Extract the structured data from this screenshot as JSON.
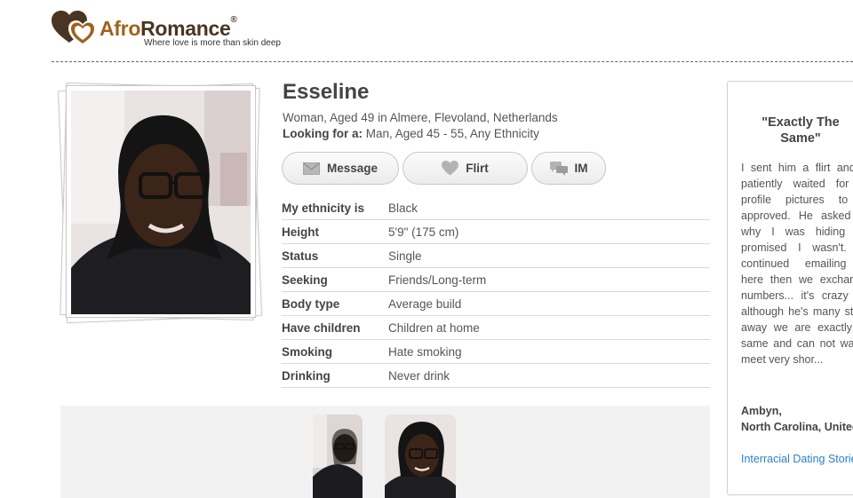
{
  "brand": {
    "name_part1": "Afro",
    "name_part2": "Romance",
    "registered_mark": "®",
    "tagline": "Where love is more than skin deep",
    "colors": {
      "primary": "#a0621e",
      "dark": "#4a3522"
    }
  },
  "profile": {
    "name": "Esseline",
    "summary": "Woman, Aged 49 in Almere, Flevoland, Netherlands",
    "looking_for_label": "Looking for a:",
    "looking_for_value": " Man, Aged 45 - 55, Any Ethnicity",
    "photo_icon": "profile-photo"
  },
  "actions": {
    "message": {
      "label": "Message",
      "icon": "envelope-icon"
    },
    "flirt": {
      "label": "Flirt",
      "icon": "heart-icon"
    },
    "im": {
      "label": "IM",
      "icon": "chat-bubbles-icon"
    }
  },
  "details": [
    {
      "label": "My ethnicity is",
      "value": "Black"
    },
    {
      "label": "Height",
      "value": "5'9\" (175 cm)"
    },
    {
      "label": "Status",
      "value": "Single"
    },
    {
      "label": "Seeking",
      "value": "Friends/Long-term"
    },
    {
      "label": "Body type",
      "value": "Average build"
    },
    {
      "label": "Have children",
      "value": "Children at home"
    },
    {
      "label": "Smoking",
      "value": "Hate smoking"
    },
    {
      "label": "Drinking",
      "value": "Never drink"
    }
  ],
  "testimonial": {
    "title": "\"Exactly The Same\"",
    "body": "I sent him a flirt and he patiently waited for my profile pictures to be approved. He asked me why I was hiding and promised I wasn't. We continued emailing on here then we exchanged numbers... it's crazy that although he's many states away we are exactly the same and can not wait to meet very shor...",
    "author_name": "Ambyn,",
    "author_location": "North Carolina, United States",
    "link_label": "Interracial Dating Stories"
  },
  "colors": {
    "link": "#2d7fc4",
    "border": "#d8d8d8",
    "strip_bg": "#f2f2f2"
  }
}
